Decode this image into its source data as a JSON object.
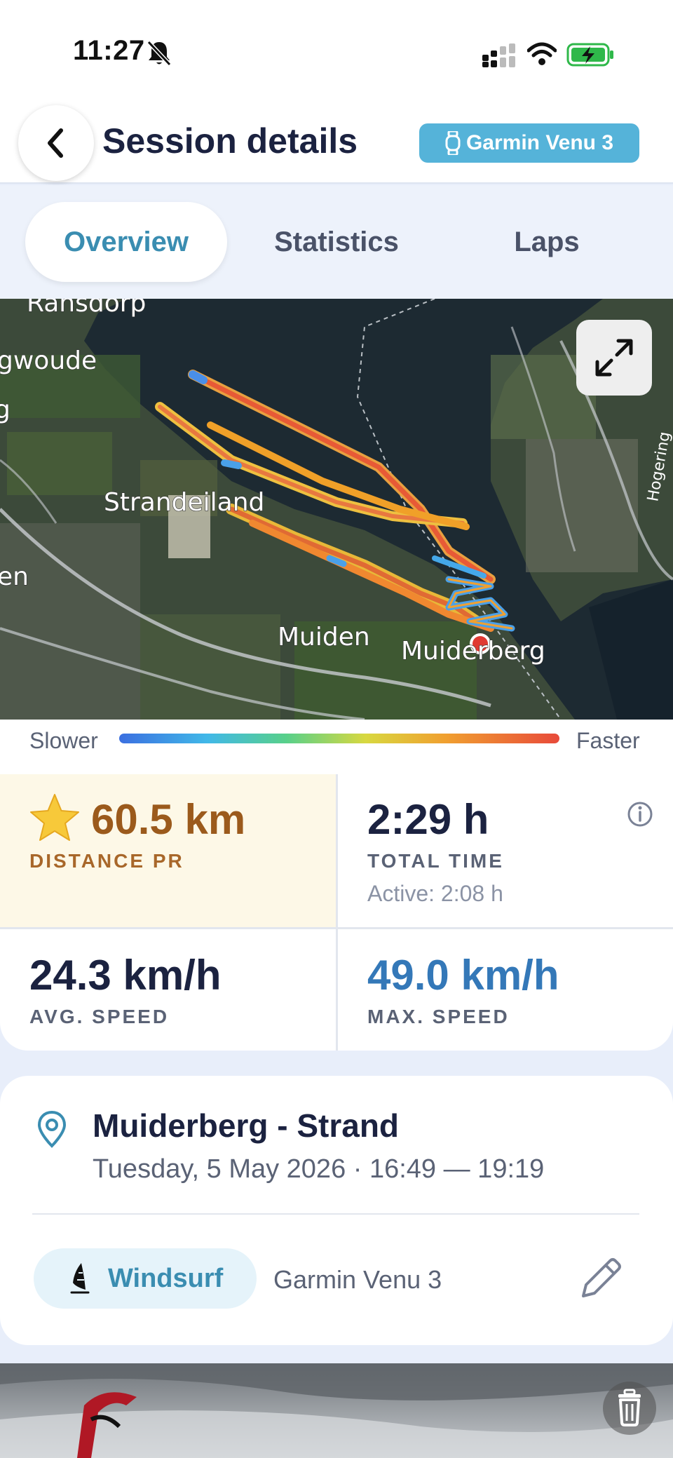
{
  "status_bar": {
    "time": "11:27"
  },
  "header": {
    "title": "Session details",
    "device_badge": "Garmin Venu 3"
  },
  "tabs": [
    {
      "label": "Overview",
      "active": true
    },
    {
      "label": "Statistics",
      "active": false
    },
    {
      "label": "Laps",
      "active": false
    }
  ],
  "map": {
    "place_labels": [
      "Ransdorp",
      "gwoude",
      "g",
      "Strandeiland",
      "en",
      "Muiden",
      "Muiderberg",
      "Hogering"
    ]
  },
  "legend": {
    "slower": "Slower",
    "faster": "Faster"
  },
  "stats": {
    "distance": {
      "value": "60.5 km",
      "label": "DISTANCE PR"
    },
    "total_time": {
      "value": "2:29 h",
      "label": "TOTAL TIME",
      "active": "Active: 2:08 h"
    },
    "avg_speed": {
      "value": "24.3 km/h",
      "label": "AVG. SPEED"
    },
    "max_speed": {
      "value": "49.0 km/h",
      "label": "MAX. SPEED"
    }
  },
  "location": {
    "name": "Muiderberg - Strand",
    "datetime": "Tuesday, 5 May 2026 · 16:49 — 19:19",
    "sport": "Windsurf",
    "device": "Garmin Venu 3"
  },
  "colors": {
    "accent": "#3a8db1",
    "badge": "#55b3d9",
    "pr_text": "#9b5a1c",
    "pr_background": "#fdf8e7",
    "max_speed": "#3478b8"
  },
  "icons": [
    "bell-slash-icon",
    "signal-icon",
    "wifi-icon",
    "battery-charging-icon",
    "chevron-left-icon",
    "watch-icon",
    "expand-icon",
    "star-icon",
    "info-icon",
    "location-pin-icon",
    "windsurf-icon",
    "pencil-icon",
    "trash-icon"
  ]
}
